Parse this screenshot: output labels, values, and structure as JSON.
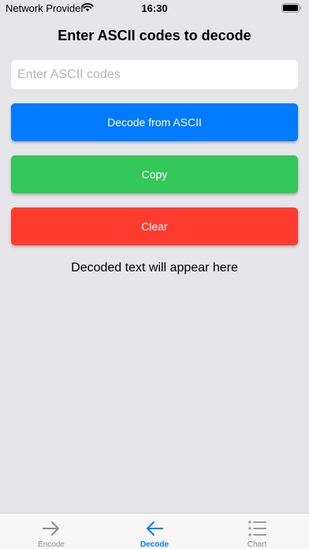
{
  "status_bar": {
    "carrier": "Network Provider",
    "time": "16:30",
    "wifi_icon": "wifi-icon",
    "battery_icon": "battery-icon"
  },
  "title": "Enter ASCII codes to decode",
  "input": {
    "value": "",
    "placeholder": "Enter ASCII codes"
  },
  "buttons": {
    "decode": {
      "label": "Decode from ASCII",
      "color": "#007aff"
    },
    "copy": {
      "label": "Copy",
      "color": "#34c759"
    },
    "clear": {
      "label": "Clear",
      "color": "#ff3b30"
    }
  },
  "result_text": "Decoded text will appear here",
  "tabs": [
    {
      "label": "Encode",
      "icon": "arrow-right-icon",
      "active": false
    },
    {
      "label": "Decode",
      "icon": "arrow-left-icon",
      "active": true
    },
    {
      "label": "Chart",
      "icon": "list-icon",
      "active": false
    }
  ],
  "colors": {
    "background": "#e6e5ea",
    "accent": "#007aff",
    "inactive_tab": "#8e8e93"
  }
}
